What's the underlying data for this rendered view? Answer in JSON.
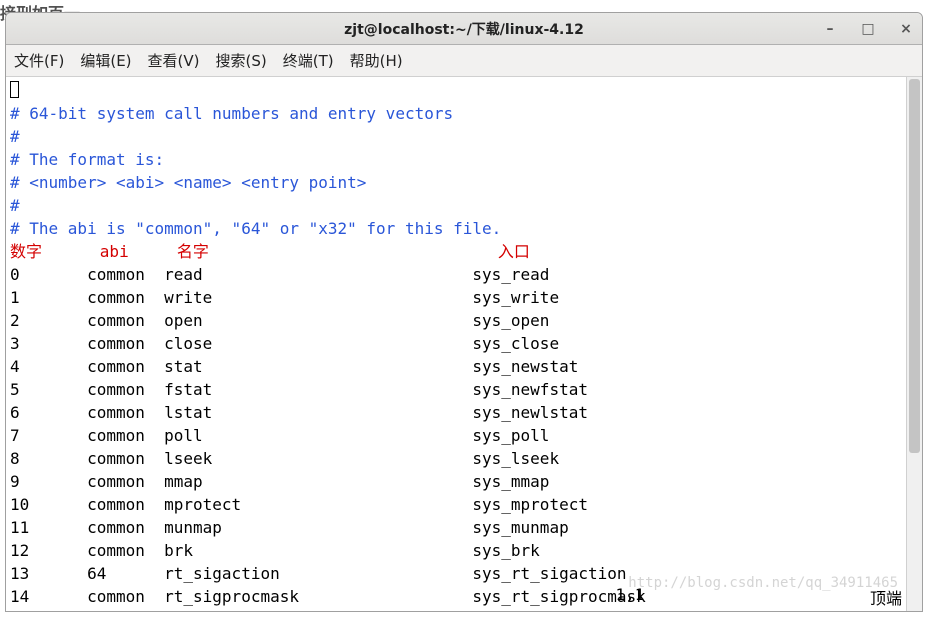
{
  "bg_text": "接刑如百一",
  "title": "zjt@localhost:~/下载/linux-4.12",
  "menus": [
    {
      "label": "文件(F)"
    },
    {
      "label": "编辑(E)"
    },
    {
      "label": "查看(V)"
    },
    {
      "label": "搜索(S)"
    },
    {
      "label": "终端(T)"
    },
    {
      "label": "帮助(H)"
    }
  ],
  "comments": [
    "#",
    "# 64-bit system call numbers and entry vectors",
    "#",
    "# The format is:",
    "# <number> <abi> <name> <entry point>",
    "#",
    "# The abi is \"common\", \"64\" or \"x32\" for this file."
  ],
  "annotation": {
    "col_num": "数字",
    "col_abi": "abi",
    "col_name": "名字",
    "col_entry": "入口"
  },
  "rows": [
    {
      "num": "0",
      "abi": "common",
      "name": "read",
      "entry": "sys_read"
    },
    {
      "num": "1",
      "abi": "common",
      "name": "write",
      "entry": "sys_write"
    },
    {
      "num": "2",
      "abi": "common",
      "name": "open",
      "entry": "sys_open"
    },
    {
      "num": "3",
      "abi": "common",
      "name": "close",
      "entry": "sys_close"
    },
    {
      "num": "4",
      "abi": "common",
      "name": "stat",
      "entry": "sys_newstat"
    },
    {
      "num": "5",
      "abi": "common",
      "name": "fstat",
      "entry": "sys_newfstat"
    },
    {
      "num": "6",
      "abi": "common",
      "name": "lstat",
      "entry": "sys_newlstat"
    },
    {
      "num": "7",
      "abi": "common",
      "name": "poll",
      "entry": "sys_poll"
    },
    {
      "num": "8",
      "abi": "common",
      "name": "lseek",
      "entry": "sys_lseek"
    },
    {
      "num": "9",
      "abi": "common",
      "name": "mmap",
      "entry": "sys_mmap"
    },
    {
      "num": "10",
      "abi": "common",
      "name": "mprotect",
      "entry": "sys_mprotect"
    },
    {
      "num": "11",
      "abi": "common",
      "name": "munmap",
      "entry": "sys_munmap"
    },
    {
      "num": "12",
      "abi": "common",
      "name": "brk",
      "entry": "sys_brk"
    },
    {
      "num": "13",
      "abi": "64",
      "name": "rt_sigaction",
      "entry": "sys_rt_sigaction"
    },
    {
      "num": "14",
      "abi": "common",
      "name": "rt_sigprocmask",
      "entry": "sys_rt_sigprocmask"
    }
  ],
  "status": {
    "position": "1,1",
    "scroll": "顶端"
  },
  "watermark": "http://blog.csdn.net/qq_34911465"
}
